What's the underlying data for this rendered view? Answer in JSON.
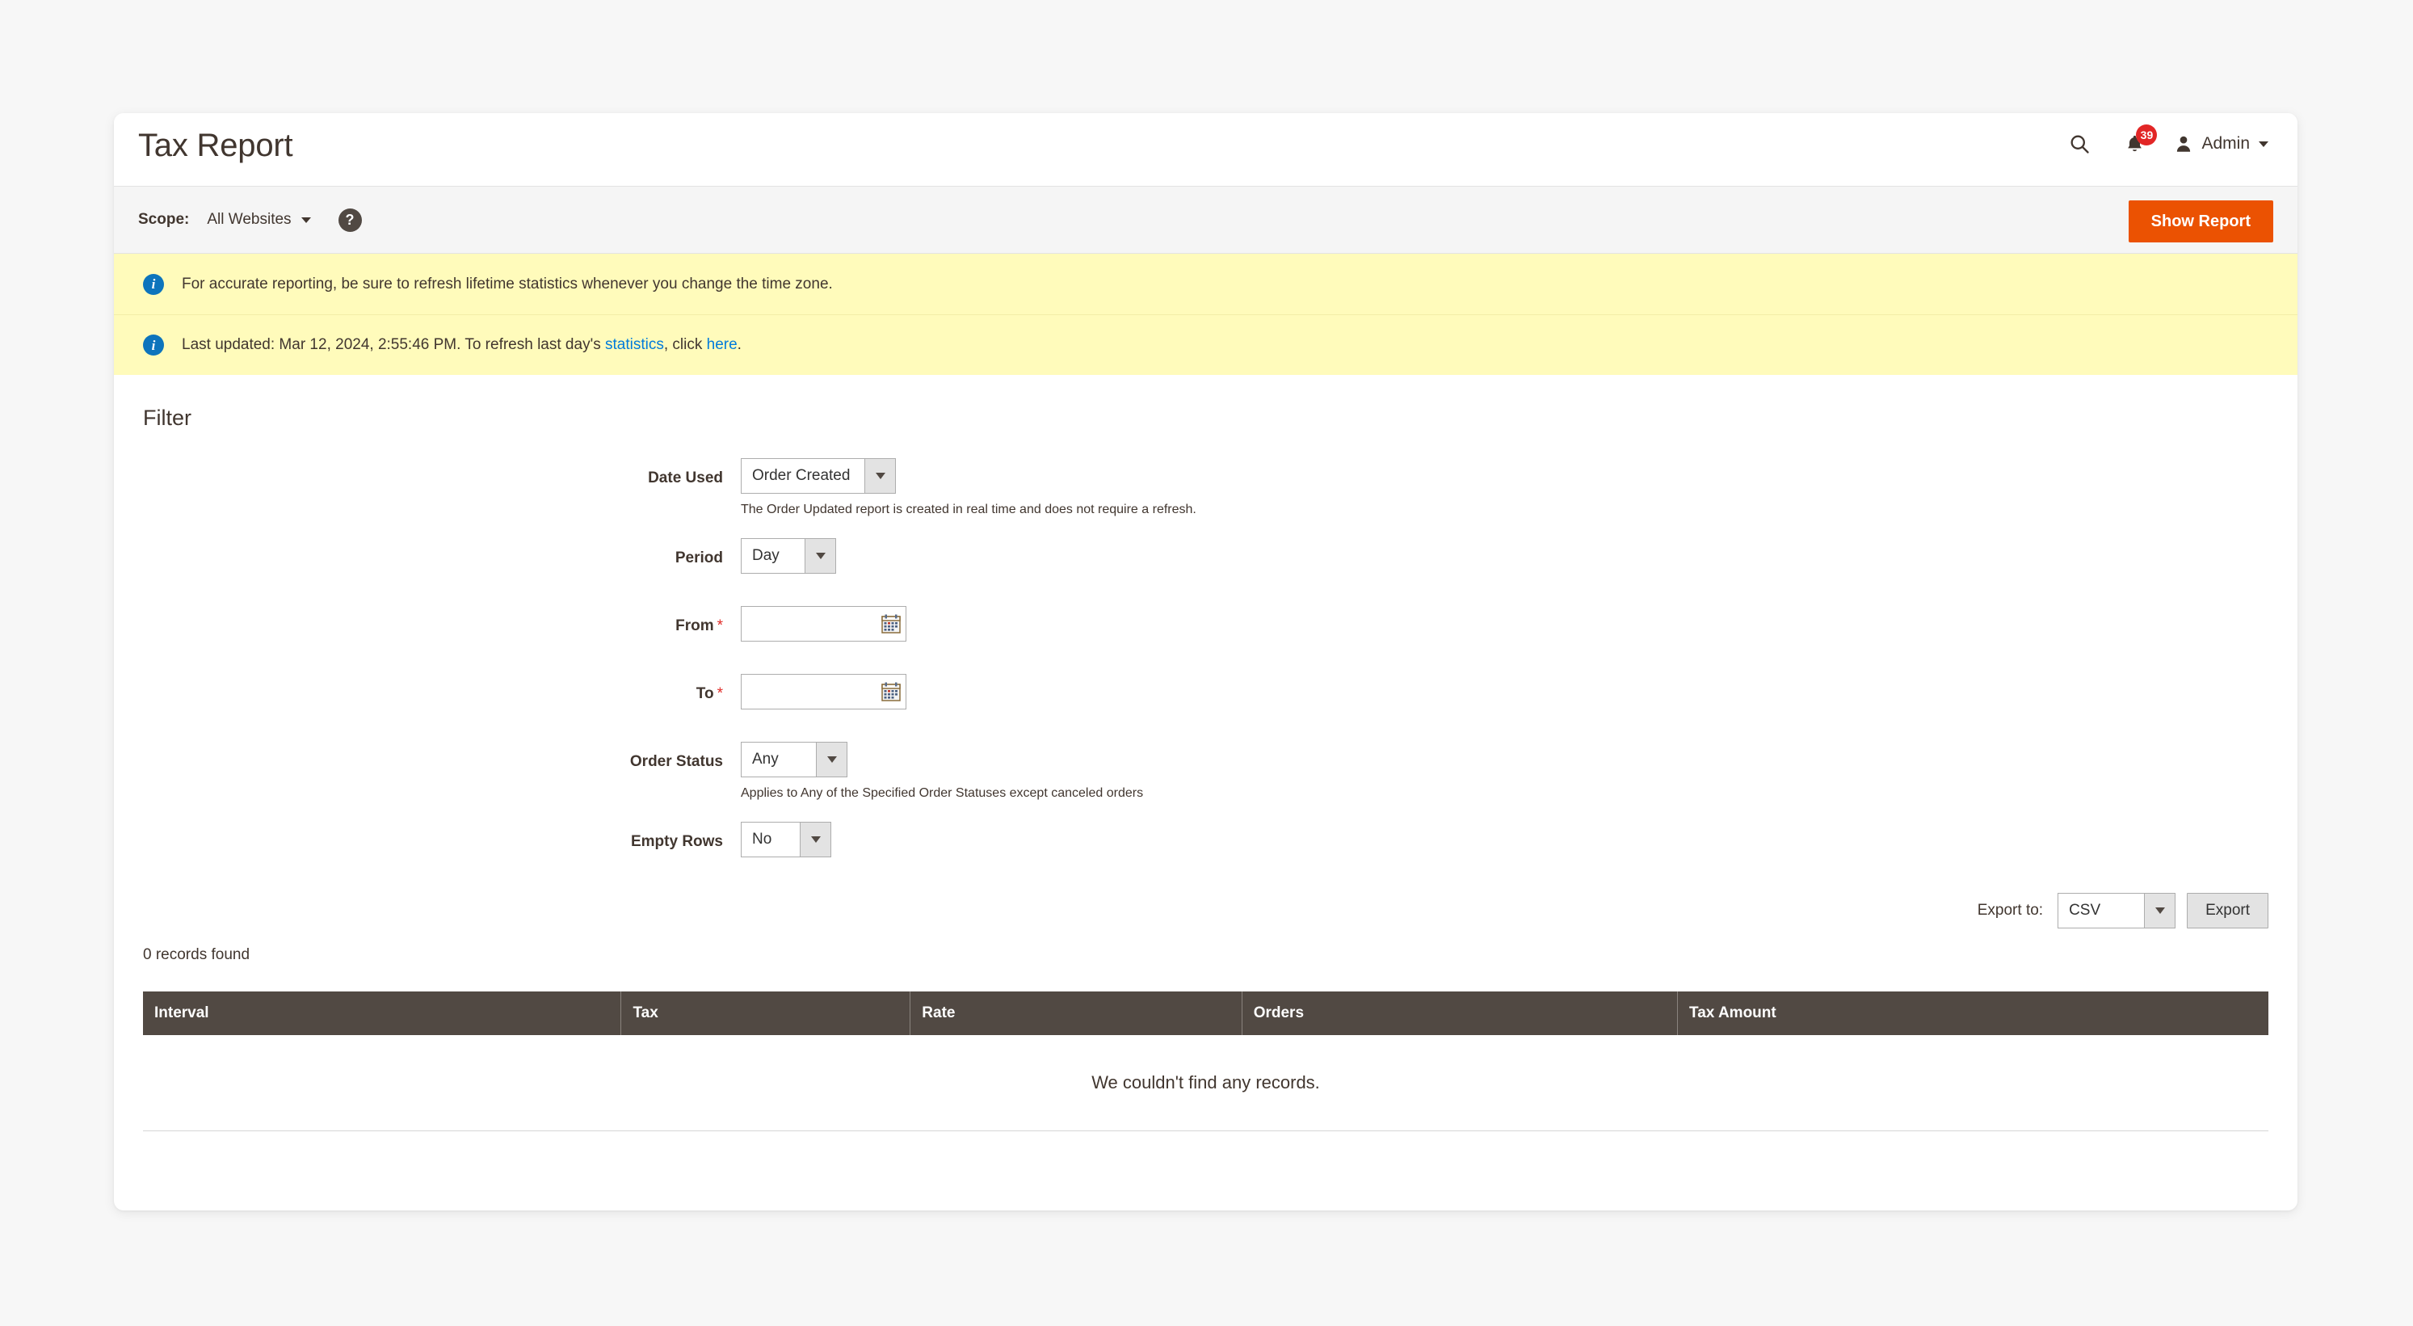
{
  "header": {
    "title": "Tax Report",
    "search_icon": "search-icon",
    "notifications": {
      "icon": "bell-icon",
      "count": "39"
    },
    "user": {
      "icon": "user-avatar-icon",
      "name": "Admin",
      "caret": "chevron-down-icon"
    }
  },
  "scope_bar": {
    "label": "Scope:",
    "value": "All Websites",
    "help_icon_glyph": "?",
    "show_report_label": "Show Report"
  },
  "messages": [
    {
      "icon": "info-icon",
      "text": "For accurate reporting, be sure to refresh lifetime statistics whenever you change the time zone."
    },
    {
      "icon": "info-icon",
      "prefix": "Last updated: Mar 12, 2024, 2:55:46 PM. To refresh last day's ",
      "link1": "statistics",
      "middle": ", click ",
      "link2": "here",
      "suffix": "."
    }
  ],
  "filter": {
    "heading": "Filter",
    "fields": {
      "date_used": {
        "label": "Date Used",
        "value": "Order Created",
        "hint": "The Order Updated report is created in real time and does not require a refresh."
      },
      "period": {
        "label": "Period",
        "value": "Day"
      },
      "from": {
        "label": "From",
        "required": "*",
        "value": "",
        "placeholder": "",
        "icon": "calendar-icon"
      },
      "to": {
        "label": "To",
        "required": "*",
        "value": "",
        "placeholder": "",
        "icon": "calendar-icon"
      },
      "order_status": {
        "label": "Order Status",
        "value": "Any",
        "hint": "Applies to Any of the Specified Order Statuses except canceled orders"
      },
      "empty_rows": {
        "label": "Empty Rows",
        "value": "No"
      }
    }
  },
  "export": {
    "label": "Export to:",
    "format": "CSV",
    "button_label": "Export"
  },
  "grid": {
    "records_found": "0 records found",
    "columns": [
      "Interval",
      "Tax",
      "Rate",
      "Orders",
      "Tax Amount"
    ],
    "rows": [],
    "empty_message": "We couldn't find any records."
  },
  "colors": {
    "accent_orange": "#eb5202",
    "badge_red": "#e22626",
    "grid_header": "#514943",
    "message_bg": "#fffbbb",
    "link_blue": "#007bdb",
    "info_blue": "#0d74bc"
  }
}
